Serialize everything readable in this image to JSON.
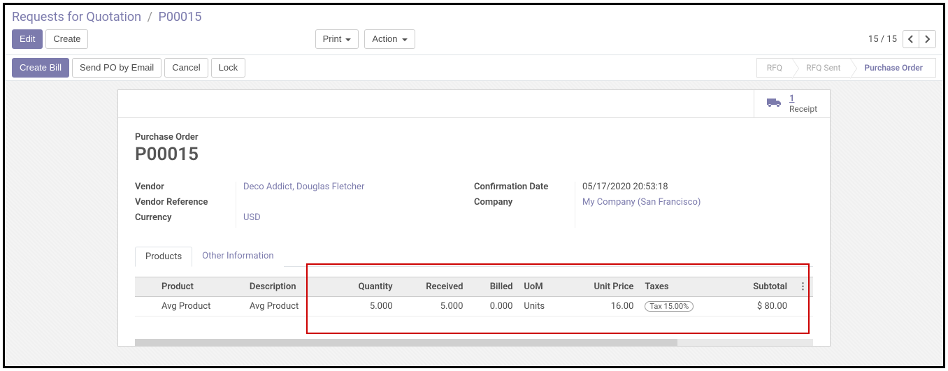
{
  "breadcrumb": {
    "root": "Requests for Quotation",
    "current": "P00015"
  },
  "toolbar": {
    "edit": "Edit",
    "create": "Create",
    "print": "Print",
    "action": "Action",
    "pager": "15 / 15"
  },
  "actions": {
    "create_bill": "Create Bill",
    "send_po": "Send PO by Email",
    "cancel": "Cancel",
    "lock": "Lock"
  },
  "status": {
    "rfq": "RFQ",
    "rfq_sent": "RFQ Sent",
    "po": "Purchase Order"
  },
  "stat": {
    "count": "1",
    "label": "Receipt"
  },
  "header": {
    "label": "Purchase Order",
    "name": "P00015"
  },
  "fields": {
    "vendor_label": "Vendor",
    "vendor": "Deco Addict, Douglas Fletcher",
    "vendor_ref_label": "Vendor Reference",
    "vendor_ref": "",
    "currency_label": "Currency",
    "currency": "USD",
    "confirm_label": "Confirmation Date",
    "confirm": "05/17/2020 20:53:18",
    "company_label": "Company",
    "company": "My Company (San Francisco)"
  },
  "tabs": {
    "products": "Products",
    "other": "Other Information"
  },
  "table": {
    "headers": {
      "product": "Product",
      "description": "Description",
      "quantity": "Quantity",
      "received": "Received",
      "billed": "Billed",
      "uom": "UoM",
      "unit_price": "Unit Price",
      "taxes": "Taxes",
      "subtotal": "Subtotal"
    },
    "row": {
      "product": "Avg Product",
      "description": "Avg Product",
      "quantity": "5.000",
      "received": "5.000",
      "billed": "0.000",
      "uom": "Units",
      "unit_price": "16.00",
      "taxes": "Tax 15.00%",
      "subtotal": "$ 80.00"
    }
  }
}
